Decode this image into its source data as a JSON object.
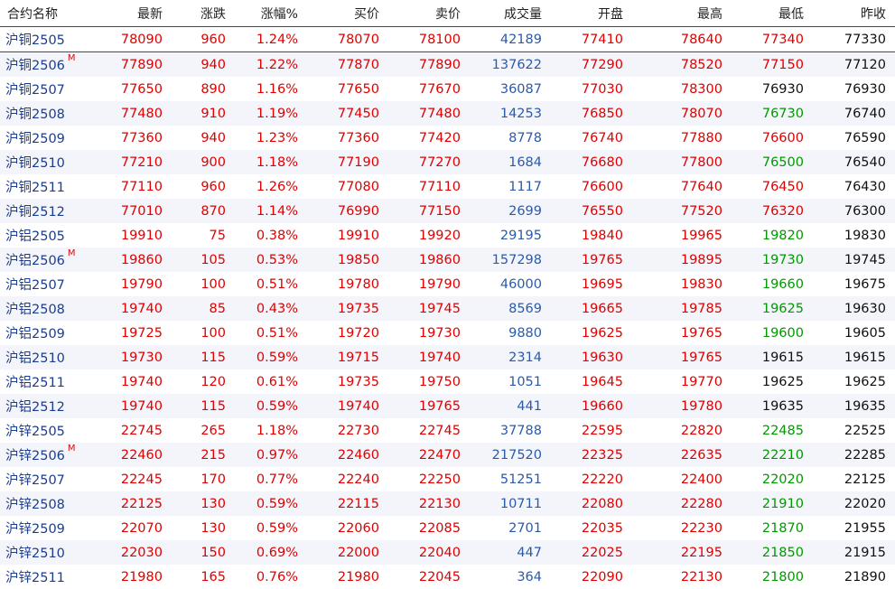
{
  "colors": {
    "up": "#e00000",
    "down": "#009900",
    "flat": "#111111",
    "volume": "#2b5aa8",
    "name": "#1a3d8f"
  },
  "headers": [
    "合约名称",
    "最新",
    "涨跌",
    "涨幅%",
    "买价",
    "卖价",
    "成交量",
    "开盘",
    "最高",
    "最低",
    "昨收"
  ],
  "rows": [
    {
      "name": "沪铜2505",
      "main": false,
      "last": "78090",
      "chg": "960",
      "pct": "1.24%",
      "bid": "78070",
      "ask": "78100",
      "vol": "42189",
      "open": "77410",
      "high": "78640",
      "low": "77340",
      "prev": "77330"
    },
    {
      "name": "沪铜2506",
      "main": true,
      "last": "77890",
      "chg": "940",
      "pct": "1.22%",
      "bid": "77870",
      "ask": "77890",
      "vol": "137622",
      "open": "77290",
      "high": "78520",
      "low": "77150",
      "prev": "77120"
    },
    {
      "name": "沪铜2507",
      "main": false,
      "last": "77650",
      "chg": "890",
      "pct": "1.16%",
      "bid": "77650",
      "ask": "77670",
      "vol": "36087",
      "open": "77030",
      "high": "78300",
      "low": "76930",
      "prev": "76930"
    },
    {
      "name": "沪铜2508",
      "main": false,
      "last": "77480",
      "chg": "910",
      "pct": "1.19%",
      "bid": "77450",
      "ask": "77480",
      "vol": "14253",
      "open": "76850",
      "high": "78070",
      "low": "76730",
      "prev": "76740"
    },
    {
      "name": "沪铜2509",
      "main": false,
      "last": "77360",
      "chg": "940",
      "pct": "1.23%",
      "bid": "77360",
      "ask": "77420",
      "vol": "8778",
      "open": "76740",
      "high": "77880",
      "low": "76600",
      "prev": "76590"
    },
    {
      "name": "沪铜2510",
      "main": false,
      "last": "77210",
      "chg": "900",
      "pct": "1.18%",
      "bid": "77190",
      "ask": "77270",
      "vol": "1684",
      "open": "76680",
      "high": "77800",
      "low": "76500",
      "prev": "76540"
    },
    {
      "name": "沪铜2511",
      "main": false,
      "last": "77110",
      "chg": "960",
      "pct": "1.26%",
      "bid": "77080",
      "ask": "77110",
      "vol": "1117",
      "open": "76600",
      "high": "77640",
      "low": "76450",
      "prev": "76430"
    },
    {
      "name": "沪铜2512",
      "main": false,
      "last": "77010",
      "chg": "870",
      "pct": "1.14%",
      "bid": "76990",
      "ask": "77150",
      "vol": "2699",
      "open": "76550",
      "high": "77520",
      "low": "76320",
      "prev": "76300"
    },
    {
      "name": "沪铝2505",
      "main": false,
      "last": "19910",
      "chg": "75",
      "pct": "0.38%",
      "bid": "19910",
      "ask": "19920",
      "vol": "29195",
      "open": "19840",
      "high": "19965",
      "low": "19820",
      "prev": "19830"
    },
    {
      "name": "沪铝2506",
      "main": true,
      "last": "19860",
      "chg": "105",
      "pct": "0.53%",
      "bid": "19850",
      "ask": "19860",
      "vol": "157298",
      "open": "19765",
      "high": "19895",
      "low": "19730",
      "prev": "19745"
    },
    {
      "name": "沪铝2507",
      "main": false,
      "last": "19790",
      "chg": "100",
      "pct": "0.51%",
      "bid": "19780",
      "ask": "19790",
      "vol": "46000",
      "open": "19695",
      "high": "19830",
      "low": "19660",
      "prev": "19675"
    },
    {
      "name": "沪铝2508",
      "main": false,
      "last": "19740",
      "chg": "85",
      "pct": "0.43%",
      "bid": "19735",
      "ask": "19745",
      "vol": "8569",
      "open": "19665",
      "high": "19785",
      "low": "19625",
      "prev": "19630"
    },
    {
      "name": "沪铝2509",
      "main": false,
      "last": "19725",
      "chg": "100",
      "pct": "0.51%",
      "bid": "19720",
      "ask": "19730",
      "vol": "9880",
      "open": "19625",
      "high": "19765",
      "low": "19600",
      "prev": "19605"
    },
    {
      "name": "沪铝2510",
      "main": false,
      "last": "19730",
      "chg": "115",
      "pct": "0.59%",
      "bid": "19715",
      "ask": "19740",
      "vol": "2314",
      "open": "19630",
      "high": "19765",
      "low": "19615",
      "prev": "19615"
    },
    {
      "name": "沪铝2511",
      "main": false,
      "last": "19740",
      "chg": "120",
      "pct": "0.61%",
      "bid": "19735",
      "ask": "19750",
      "vol": "1051",
      "open": "19645",
      "high": "19770",
      "low": "19625",
      "prev": "19625"
    },
    {
      "name": "沪铝2512",
      "main": false,
      "last": "19740",
      "chg": "115",
      "pct": "0.59%",
      "bid": "19740",
      "ask": "19765",
      "vol": "441",
      "open": "19660",
      "high": "19780",
      "low": "19635",
      "prev": "19635"
    },
    {
      "name": "沪锌2505",
      "main": false,
      "last": "22745",
      "chg": "265",
      "pct": "1.18%",
      "bid": "22730",
      "ask": "22745",
      "vol": "37788",
      "open": "22595",
      "high": "22820",
      "low": "22485",
      "prev": "22525"
    },
    {
      "name": "沪锌2506",
      "main": true,
      "last": "22460",
      "chg": "215",
      "pct": "0.97%",
      "bid": "22460",
      "ask": "22470",
      "vol": "217520",
      "open": "22325",
      "high": "22635",
      "low": "22210",
      "prev": "22285"
    },
    {
      "name": "沪锌2507",
      "main": false,
      "last": "22245",
      "chg": "170",
      "pct": "0.77%",
      "bid": "22240",
      "ask": "22250",
      "vol": "51251",
      "open": "22220",
      "high": "22400",
      "low": "22020",
      "prev": "22125"
    },
    {
      "name": "沪锌2508",
      "main": false,
      "last": "22125",
      "chg": "130",
      "pct": "0.59%",
      "bid": "22115",
      "ask": "22130",
      "vol": "10711",
      "open": "22080",
      "high": "22280",
      "low": "21910",
      "prev": "22020"
    },
    {
      "name": "沪锌2509",
      "main": false,
      "last": "22070",
      "chg": "130",
      "pct": "0.59%",
      "bid": "22060",
      "ask": "22085",
      "vol": "2701",
      "open": "22035",
      "high": "22230",
      "low": "21870",
      "prev": "21955"
    },
    {
      "name": "沪锌2510",
      "main": false,
      "last": "22030",
      "chg": "150",
      "pct": "0.69%",
      "bid": "22000",
      "ask": "22040",
      "vol": "447",
      "open": "22025",
      "high": "22195",
      "low": "21850",
      "prev": "21915"
    },
    {
      "name": "沪锌2511",
      "main": false,
      "last": "21980",
      "chg": "165",
      "pct": "0.76%",
      "bid": "21980",
      "ask": "22045",
      "vol": "364",
      "open": "22090",
      "high": "22130",
      "low": "21800",
      "prev": "21890"
    }
  ],
  "main_badge": "M"
}
